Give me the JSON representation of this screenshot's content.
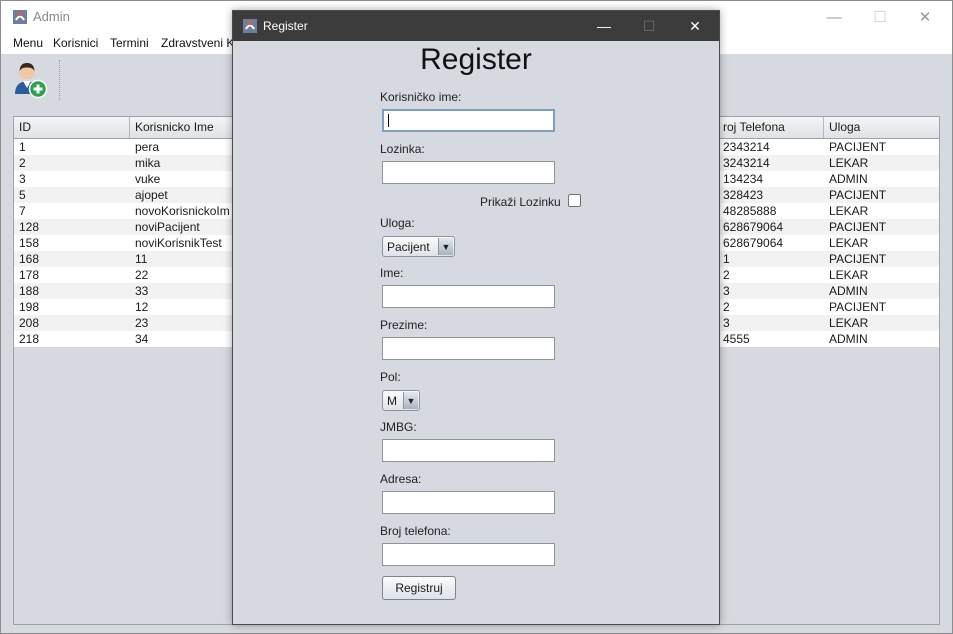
{
  "main_window": {
    "title": "Admin",
    "controls": {
      "minimize": "—",
      "maximize": "☐",
      "close": "✕"
    },
    "menu": [
      "Menu",
      "Korisnici",
      "Termini",
      "Zdravstveni K"
    ],
    "toolbar": {
      "add_user_icon": "add-user-icon"
    }
  },
  "table": {
    "columns": [
      "ID",
      "Korisnicko Ime",
      "roj Telefona",
      "Uloga"
    ],
    "rows": [
      [
        "1",
        "pera",
        "2343214",
        "PACIJENT"
      ],
      [
        "2",
        "mika",
        "3243214",
        "LEKAR"
      ],
      [
        "3",
        "vuke",
        "134234",
        "ADMIN"
      ],
      [
        "5",
        "ajopet",
        "328423",
        "PACIJENT"
      ],
      [
        "7",
        "novoKorisnickoIm",
        "48285888",
        "LEKAR"
      ],
      [
        "128",
        "noviPacijent",
        "628679064",
        "PACIJENT"
      ],
      [
        "158",
        "noviKorisnikTest",
        "628679064",
        "LEKAR"
      ],
      [
        "168",
        "11",
        "1",
        "PACIJENT"
      ],
      [
        "178",
        "22",
        "2",
        "LEKAR"
      ],
      [
        "188",
        "33",
        "3",
        "ADMIN"
      ],
      [
        "198",
        "12",
        "2",
        "PACIJENT"
      ],
      [
        "208",
        "23",
        "3",
        "LEKAR"
      ],
      [
        "218",
        "34",
        "4555",
        "ADMIN"
      ]
    ]
  },
  "dialog": {
    "title": "Register",
    "controls": {
      "minimize": "—",
      "maximize": "☐",
      "close": "✕"
    },
    "heading": "Register",
    "labels": {
      "username": "Korisničko ime:",
      "password": "Lozinka:",
      "show_password": "Prikaži Lozinku",
      "role": "Uloga:",
      "first_name": "Ime:",
      "last_name": "Prezime:",
      "gender": "Pol:",
      "jmbg": "JMBG:",
      "address": "Adresa:",
      "phone": "Broj telefona:"
    },
    "values": {
      "username": "",
      "password": "",
      "first_name": "",
      "last_name": "",
      "jmbg": "",
      "address": "",
      "phone": ""
    },
    "role_selected": "Pacijent",
    "gender_selected": "M",
    "show_password_checked": false,
    "submit_label": "Registruj"
  },
  "colors": {
    "window_bg": "#d6d9df",
    "dialog_title_bg": "#3c3c3c",
    "focus_border": "#7c9fc8"
  }
}
